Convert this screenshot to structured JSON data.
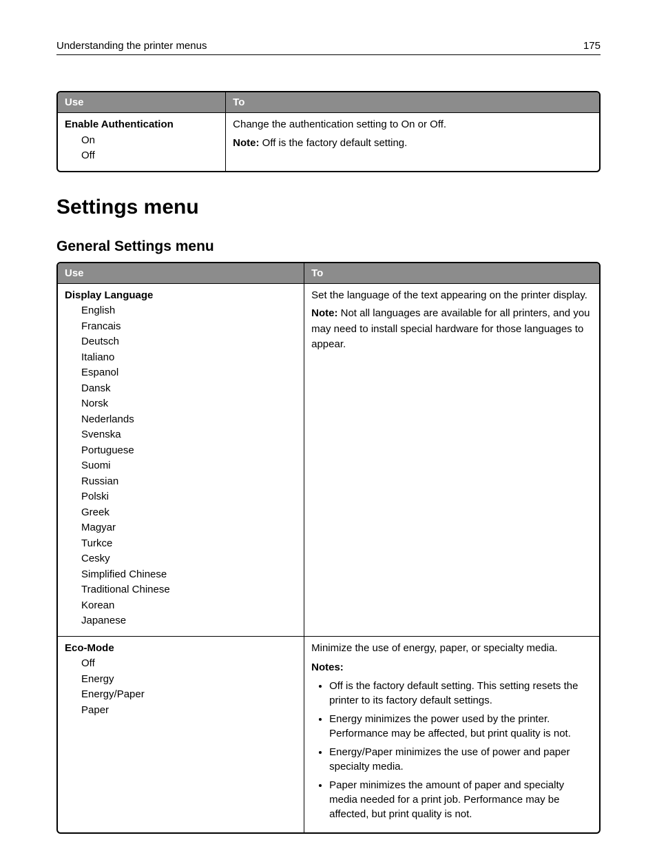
{
  "header": {
    "title": "Understanding the printer menus",
    "page": "175"
  },
  "table1": {
    "col_use": "Use",
    "col_to": "To",
    "row": {
      "title": "Enable Authentication",
      "options": [
        "On",
        "Off"
      ],
      "desc": "Change the authentication setting to On or Off.",
      "note_label": "Note:",
      "note_text": " Off is the factory default setting."
    }
  },
  "section_heading": "Settings menu",
  "subsection_heading": "General Settings menu",
  "table2": {
    "col_use": "Use",
    "col_to": "To",
    "rows": [
      {
        "title": "Display Language",
        "options": [
          "English",
          "Francais",
          "Deutsch",
          "Italiano",
          "Espanol",
          "Dansk",
          "Norsk",
          "Nederlands",
          "Svenska",
          "Portuguese",
          "Suomi",
          "Russian",
          "Polski",
          "Greek",
          "Magyar",
          "Turkce",
          "Cesky",
          "Simplified Chinese",
          "Traditional Chinese",
          "Korean",
          "Japanese"
        ],
        "desc": "Set the language of the text appearing on the printer display.",
        "note_label": "Note:",
        "note_text": " Not all languages are available for all printers, and you may need to install special hardware for those languages to appear."
      },
      {
        "title": "Eco-Mode",
        "options": [
          "Off",
          "Energy",
          "Energy/Paper",
          "Paper"
        ],
        "desc": "Minimize the use of energy, paper, or specialty media.",
        "notes_label": "Notes:",
        "notes": [
          "Off is the factory default setting. This setting resets the printer to its factory default settings.",
          "Energy minimizes the power used by the printer. Performance may be affected, but print quality is not.",
          "Energy/Paper minimizes the use of power and paper specialty media.",
          "Paper minimizes the amount of paper and specialty media needed for a print job. Performance may be affected, but print quality is not."
        ]
      }
    ]
  }
}
